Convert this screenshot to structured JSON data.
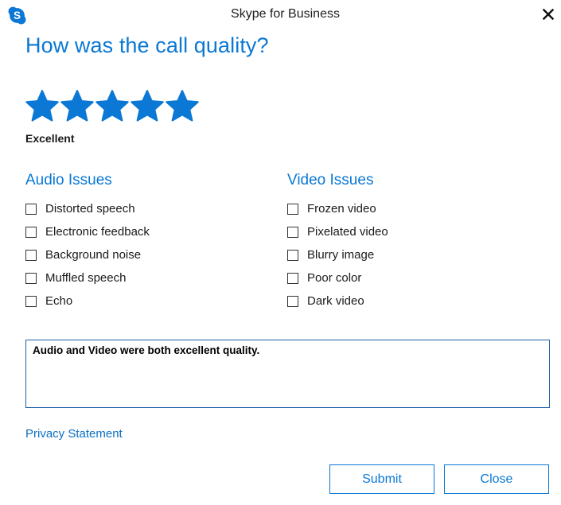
{
  "window": {
    "title": "Skype for Business",
    "icon": "skype-logo-icon",
    "close_icon": "close-icon"
  },
  "heading": "How was the call quality?",
  "rating": {
    "value": 5,
    "max": 5,
    "label": "Excellent",
    "star_color": "#0a78d4"
  },
  "audio": {
    "title": "Audio Issues",
    "options": [
      {
        "label": "Distorted speech",
        "checked": false
      },
      {
        "label": "Electronic feedback",
        "checked": false
      },
      {
        "label": "Background noise",
        "checked": false
      },
      {
        "label": "Muffled speech",
        "checked": false
      },
      {
        "label": "Echo",
        "checked": false
      }
    ]
  },
  "video": {
    "title": "Video Issues",
    "options": [
      {
        "label": "Frozen video",
        "checked": false
      },
      {
        "label": "Pixelated video",
        "checked": false
      },
      {
        "label": "Blurry image",
        "checked": false
      },
      {
        "label": "Poor color",
        "checked": false
      },
      {
        "label": "Dark video",
        "checked": false
      }
    ]
  },
  "comment": {
    "value": "Audio and Video were both excellent quality."
  },
  "privacy_link": "Privacy Statement",
  "buttons": {
    "submit": "Submit",
    "close": "Close"
  },
  "colors": {
    "accent": "#0a78d4",
    "text": "#1a1a1a",
    "border": "#1f5fa8"
  }
}
